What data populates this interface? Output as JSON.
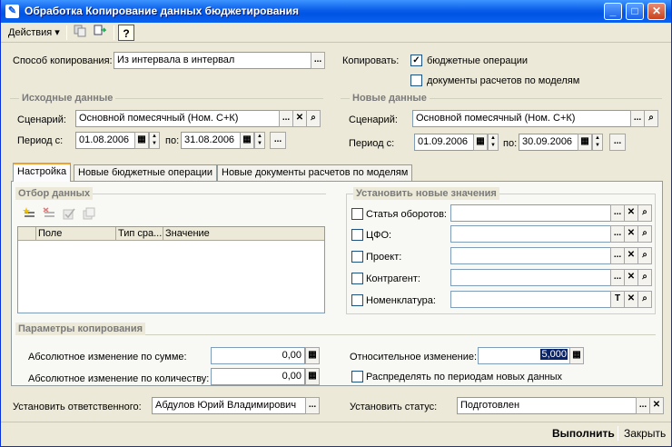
{
  "window": {
    "title": "Обработка  Копирование данных бюджетирования",
    "icon": "✎",
    "minimize": "_",
    "maximize": "□",
    "close": "✕"
  },
  "toolbar": {
    "actions": "Действия",
    "help": "?"
  },
  "top": {
    "method_label": "Способ копирования:",
    "method_value": "Из интервала в интервал",
    "copy_label": "Копировать:",
    "opt1": "бюджетные операции",
    "opt2": "документы расчетов по моделям"
  },
  "source": {
    "title": "Исходные данные",
    "scenario_label": "Сценарий:",
    "scenario": "Основной помесячный (Ном. С+К)",
    "period_label": "Период с:",
    "from": "01.08.2006",
    "to_label": "по:",
    "to": "31.08.2006"
  },
  "target": {
    "title": "Новые данные",
    "scenario_label": "Сценарий:",
    "scenario": "Основной помесячный (Ном. С+К)",
    "period_label": "Период с:",
    "from": "01.09.2006",
    "to_label": "по:",
    "to": "30.09.2006"
  },
  "tabs": [
    "Настройка",
    "Новые бюджетные операции",
    "Новые документы расчетов по моделям"
  ],
  "filter": {
    "title": "Отбор данных",
    "columns": [
      "Поле",
      "Тип сра...",
      "Значение"
    ]
  },
  "newvals": {
    "title": "Установить новые значения",
    "items": [
      "Статья оборотов:",
      "ЦФО:",
      "Проект:",
      "Контрагент:",
      "Номенклатура:"
    ]
  },
  "params": {
    "title": "Параметры копирования",
    "abs_sum_label": "Абсолютное изменение по сумме:",
    "abs_sum": "0,00",
    "abs_qty_label": "Абсолютное изменение по количеству:",
    "abs_qty": "0,00",
    "rel_label": "Относительное изменение:",
    "rel": "5,000",
    "distribute": "Распределять по периодам новых данных"
  },
  "resp": {
    "label": "Установить ответственного:",
    "value": "Абдулов Юрий Владимирович"
  },
  "status": {
    "label": "Установить статус:",
    "value": "Подготовлен"
  },
  "buttons": {
    "run": "Выполнить",
    "close": "Закрыть"
  },
  "glyphs": {
    "ellipsis": "...",
    "clear": "✕",
    "search": "⌕",
    "check": "✓",
    "calendar": "▦",
    "calc": "▦",
    "text": "T",
    "up": "▲",
    "down": "▼",
    "arrow": "▾"
  }
}
